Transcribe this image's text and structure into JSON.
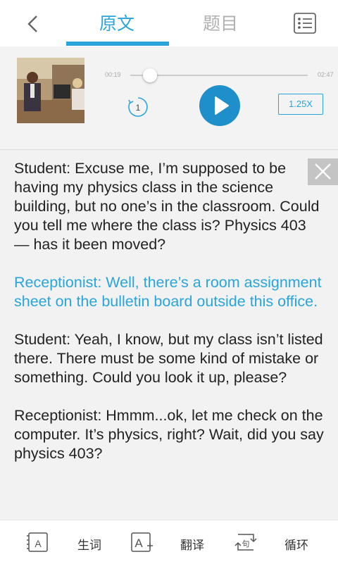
{
  "header": {
    "tabs": [
      {
        "label": "原文",
        "active": true
      },
      {
        "label": "题目",
        "active": false
      }
    ],
    "accent_color": "#2aa5db",
    "icons": {
      "back": "chevron-left-icon",
      "menu": "list-icon"
    }
  },
  "player": {
    "current_time": "00:19",
    "total_time": "02:47",
    "progress": 0.11,
    "loop_count": "1",
    "speed": "1.25X",
    "state": "paused",
    "icons": {
      "play": "play-icon",
      "loop": "repeat-icon"
    }
  },
  "transcript": {
    "paragraphs": [
      {
        "text": "Student: Excuse me, I’m supposed to be having my physics class in the science building, but no one’s in the classroom. Could you tell me where the class is? Physics 403 — has it been moved?",
        "highlighted": false
      },
      {
        "text": "Receptionist: Well, there’s a room assignment sheet on the bulletin board outside this office.",
        "highlighted": true
      },
      {
        "text": "Student: Yeah, I know, but my class isn’t listed there. There must be some kind of mistake or something. Could you look it up, please?",
        "highlighted": false
      },
      {
        "text": "Receptionist: Hmmm...ok, let me check on the computer. It’s physics, right? Wait, did you say physics 403?",
        "highlighted": false
      }
    ]
  },
  "toolbar": {
    "items": [
      {
        "label": "生词",
        "icon": "vocabulary-icon"
      },
      {
        "label": "翻译",
        "icon": "translate-icon"
      },
      {
        "label": "循环",
        "icon": "sentence-loop-icon"
      }
    ]
  }
}
